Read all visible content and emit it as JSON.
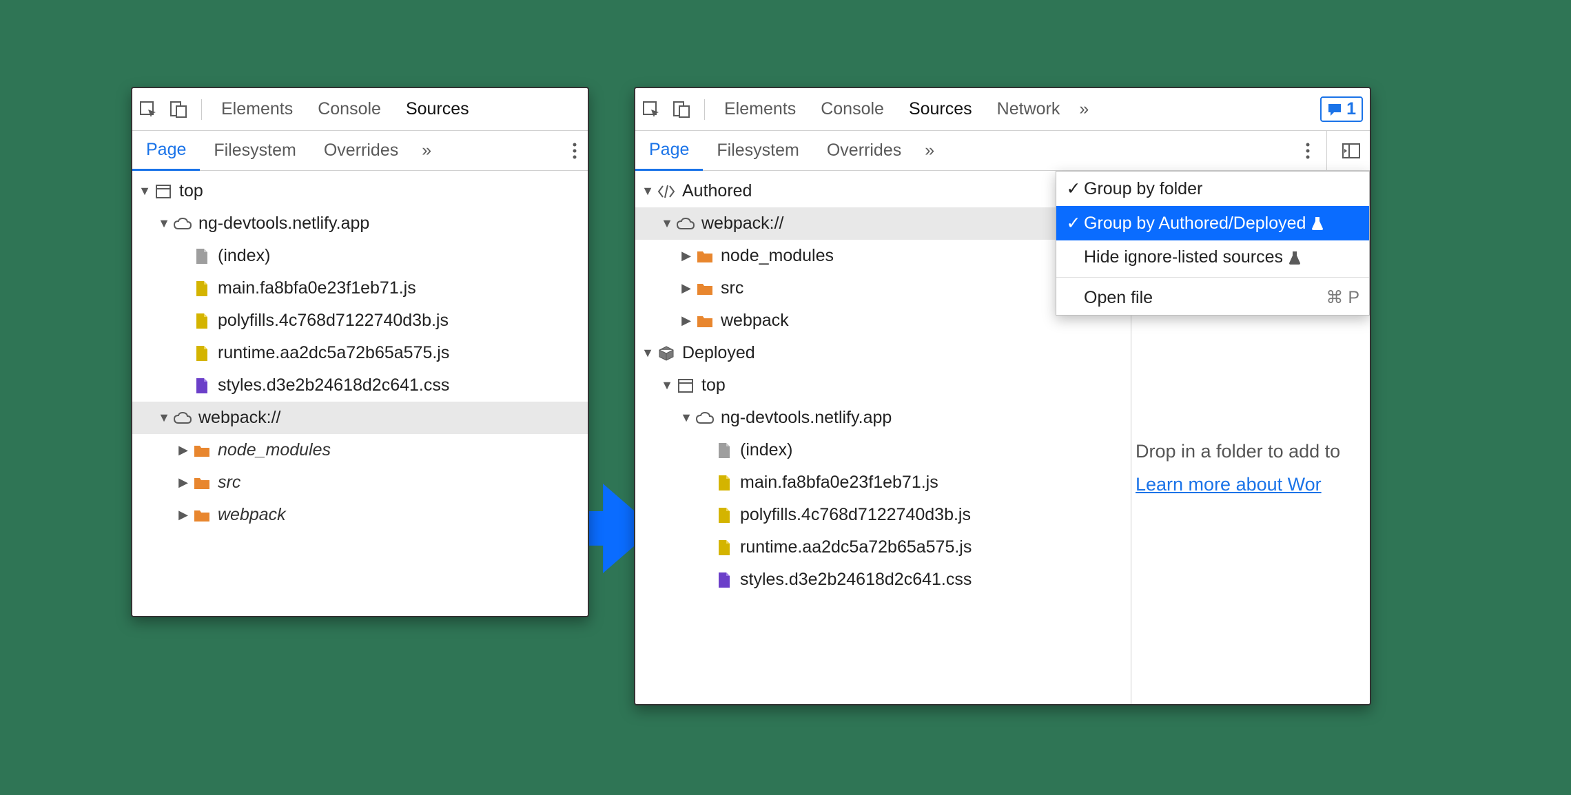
{
  "tabs": {
    "elements": "Elements",
    "console": "Console",
    "sources": "Sources",
    "network": "Network",
    "issues_count": "1"
  },
  "subtabs": {
    "page": "Page",
    "filesystem": "Filesystem",
    "overrides": "Overrides"
  },
  "left_tree": {
    "top": "top",
    "domain": "ng-devtools.netlify.app",
    "files": {
      "index": "(index)",
      "main": "main.fa8bfa0e23f1eb71.js",
      "poly": "polyfills.4c768d7122740d3b.js",
      "runtime": "runtime.aa2dc5a72b65a575.js",
      "styles": "styles.d3e2b24618d2c641.css"
    },
    "webpack": "webpack://",
    "folders": {
      "node_modules": "node_modules",
      "src": "src",
      "webpack": "webpack"
    }
  },
  "right_tree": {
    "authored": "Authored",
    "webpack": "webpack://",
    "folders": {
      "node_modules": "node_modules",
      "src": "src",
      "webpack": "webpack"
    },
    "deployed": "Deployed",
    "top": "top",
    "domain": "ng-devtools.netlify.app",
    "files": {
      "index": "(index)",
      "main": "main.fa8bfa0e23f1eb71.js",
      "poly": "polyfills.4c768d7122740d3b.js",
      "runtime": "runtime.aa2dc5a72b65a575.js",
      "styles": "styles.d3e2b24618d2c641.css"
    }
  },
  "menu": {
    "group_folder": "Group by folder",
    "group_authored": "Group by Authored/Deployed",
    "hide_ignored": "Hide ignore-listed sources",
    "open_file": "Open file",
    "open_file_shortcut": "⌘ P"
  },
  "rtext": {
    "drop": "Drop in a folder to add to",
    "learn": "Learn more about Wor"
  }
}
